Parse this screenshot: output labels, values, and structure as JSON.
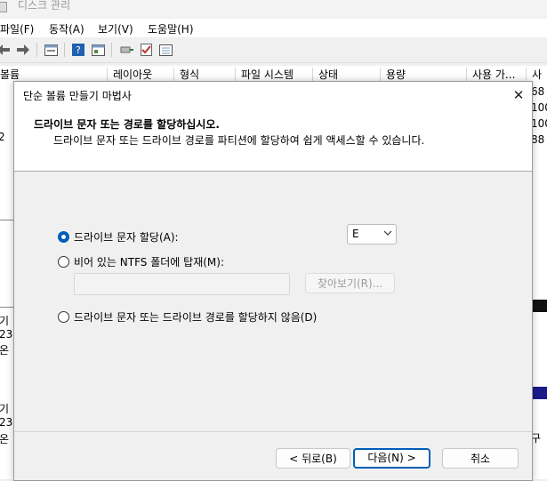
{
  "window": {
    "title": "디스크 관리"
  },
  "menu": [
    "파일(F)",
    "동작(A)",
    "보기(V)",
    "도움말(H)"
  ],
  "toolbar_icons": [
    "back-arrow-icon",
    "forward-arrow-icon",
    "properties-icon",
    "help-icon",
    "console-icon",
    "connect-icon",
    "check-icon",
    "details-icon"
  ],
  "columns": [
    "볼륨",
    "레이아웃",
    "형식",
    "파일 시스템",
    "상태",
    "용량",
    "사용 가...",
    "사"
  ],
  "right_values": [
    "68",
    "100",
    "100",
    "88"
  ],
  "left_fragments": [
    "(",
    "(",
    "2",
    "기",
    "23",
    "온",
    "기",
    "23",
    "온"
  ],
  "right_fragments": [
    "구"
  ],
  "wizard": {
    "title": "단순 볼륨 만들기 마법사",
    "close_glyph": "✕",
    "header_title": "드라이브 문자 또는 경로를 할당하십시오.",
    "header_subtitle": "드라이브 문자 또는 드라이브 경로를 파티션에 할당하여 쉽게 액세스할 수 있습니다.",
    "option_assign": "드라이브 문자 할당(A):",
    "drive_letter": "E",
    "option_mount": "비어 있는 NTFS 폴더에 탑재(M):",
    "mount_path_value": "",
    "browse": "찾아보기(R)...",
    "option_none": "드라이브 문자 또는 드라이브 경로를 할당하지 않음(D)",
    "back": "< 뒤로(B)",
    "next": "다음(N) >",
    "cancel": "취소"
  }
}
